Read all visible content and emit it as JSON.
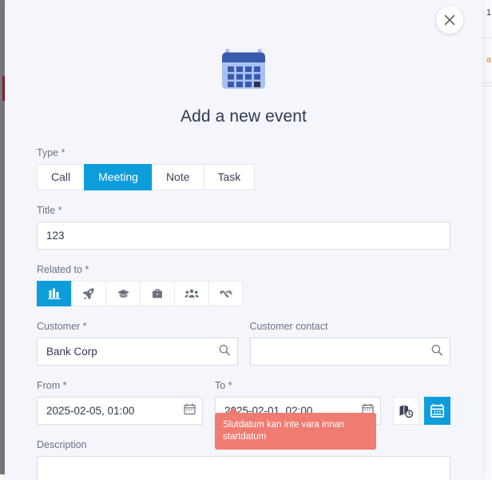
{
  "background": {
    "right_panel": {
      "cell_values": [
        "1",
        "a"
      ]
    }
  },
  "modal": {
    "title": "Add a new event",
    "hero_icon": "calendar-icon",
    "close_icon": "close-icon",
    "fields": {
      "type": {
        "label": "Type *",
        "options": [
          "Call",
          "Meeting",
          "Note",
          "Task"
        ],
        "selected": "Meeting"
      },
      "title": {
        "label": "Title *",
        "value": "123",
        "placeholder": ""
      },
      "related_to": {
        "label": "Related to *",
        "options": [
          {
            "icon": "company-chart-icon",
            "selected": true
          },
          {
            "icon": "rocket-icon",
            "selected": false
          },
          {
            "icon": "graduation-cap-icon",
            "selected": false
          },
          {
            "icon": "briefcase-icon",
            "selected": false
          },
          {
            "icon": "group-people-icon",
            "selected": false
          },
          {
            "icon": "handshake-icon",
            "selected": false
          }
        ]
      },
      "customer": {
        "label": "Customer *",
        "value": "Bank Corp",
        "placeholder": "",
        "icon": "search-icon"
      },
      "customer_contact": {
        "label": "Customer contact",
        "value": "",
        "placeholder": "",
        "icon": "search-icon"
      },
      "from": {
        "label": "From *",
        "value": "2025-02-05, 01:00",
        "icon": "calendar-small-icon"
      },
      "to": {
        "label": "To *",
        "value": "2025-02-01, 02:00",
        "icon": "calendar-small-icon",
        "error": "Slutdatum kan inte vara innan startdatum"
      },
      "timezone_button": {
        "icon": "map-clock-icon"
      },
      "calendar_button": {
        "icon": "calendar-button-icon"
      },
      "description": {
        "label": "Description",
        "value": "",
        "placeholder": ""
      }
    }
  },
  "colors": {
    "accent": "#0d9ddb",
    "error": "#ef7b72",
    "modal_bg": "#f4f6fb",
    "hero_dark": "#3a5bab",
    "hero_light": "#a8c1f5",
    "text": "#2f3a52",
    "label": "#6b7280"
  }
}
